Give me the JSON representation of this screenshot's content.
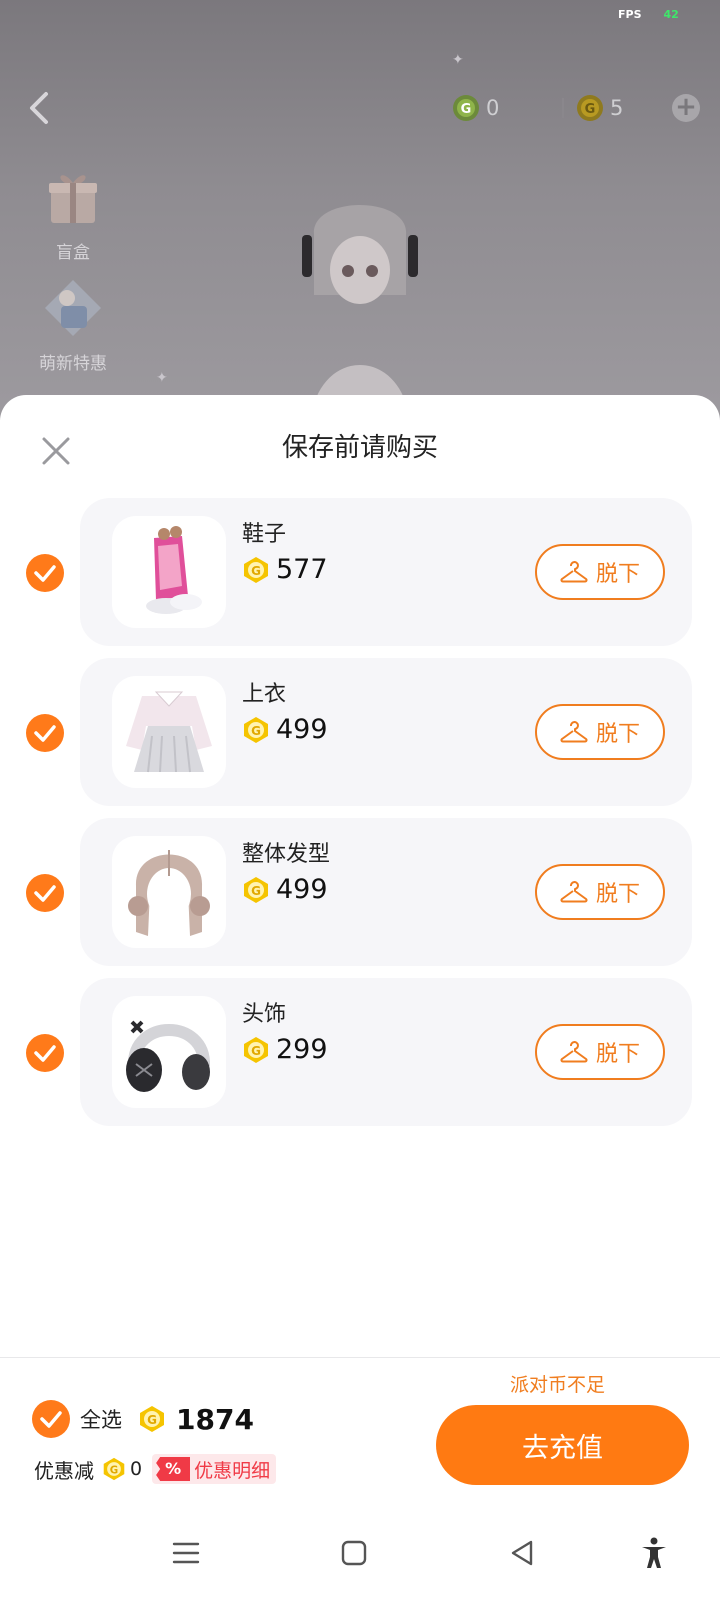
{
  "status": {
    "fps_label": "FPS",
    "fps_value": "42"
  },
  "header": {
    "currency_g_value": "0",
    "currency_coin_value": "5"
  },
  "side_menu": {
    "blind_box_label": "盲盒",
    "newbie_offer_label": "萌新特惠"
  },
  "sheet": {
    "title": "保存前请购买",
    "items": [
      {
        "name": "鞋子",
        "price": "577",
        "action_label": "脱下",
        "icon": "shoes-icon"
      },
      {
        "name": "上衣",
        "price": "499",
        "action_label": "脱下",
        "icon": "top-icon"
      },
      {
        "name": "整体发型",
        "price": "499",
        "action_label": "脱下",
        "icon": "hairstyle-icon"
      },
      {
        "name": "头饰",
        "price": "299",
        "action_label": "脱下",
        "icon": "headphones-icon"
      }
    ]
  },
  "footer": {
    "select_all_label": "全选",
    "total": "1874",
    "discount_label": "优惠减",
    "discount_value": "0",
    "discount_badge": "%",
    "discount_detail_label": "优惠明细",
    "insufficient_text": "派对币不足",
    "recharge_label": "去充值"
  },
  "colors": {
    "accent": "#ff7a12",
    "coin": "#f5c400",
    "discount_red": "#f03a46"
  }
}
